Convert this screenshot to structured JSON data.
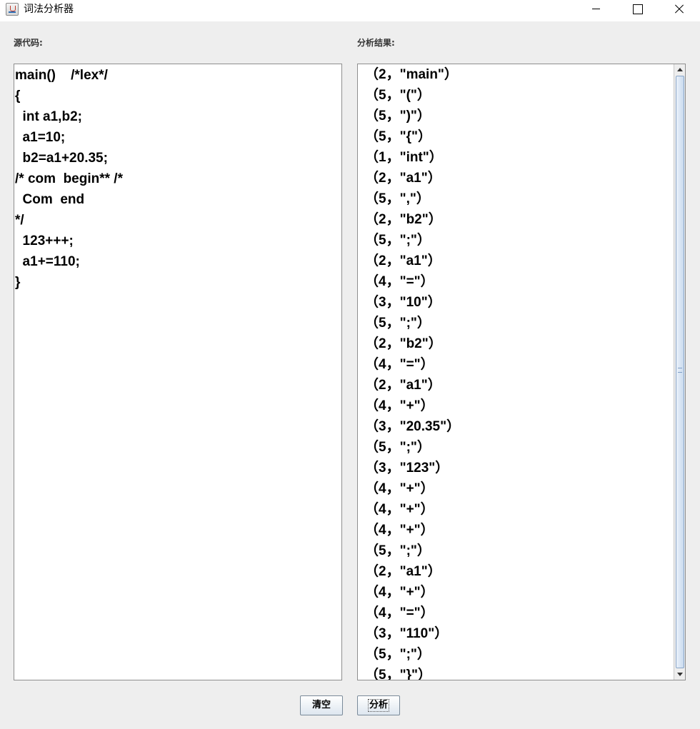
{
  "window": {
    "title": "词法分析器"
  },
  "labels": {
    "source": "源代码:",
    "result": "分析结果:"
  },
  "source_code": [
    "main()    /*lex*/",
    "{",
    "  int a1,b2;",
    "  a1=10;",
    "  b2=a1+20.35;",
    "/* com  begin** /*",
    "  Com  end",
    "*/",
    "  123+++;",
    "  a1+=110;",
    "}"
  ],
  "results": [
    "（2，\"main\"）",
    "（5，\"(\"）",
    "（5，\")\"）",
    "（5，\"{\"）",
    "（1，\"int\"）",
    "（2，\"a1\"）",
    "（5，\",\"）",
    "（2，\"b2\"）",
    "（5，\";\"）",
    "（2，\"a1\"）",
    "（4，\"=\"）",
    "（3，\"10\"）",
    "（5，\";\"）",
    "（2，\"b2\"）",
    "（4，\"=\"）",
    "（2，\"a1\"）",
    "（4，\"+\"）",
    "（3，\"20.35\"）",
    "（5，\";\"）",
    "（3，\"123\"）",
    "（4，\"+\"）",
    "（4，\"+\"）",
    "（4，\"+\"）",
    "（5，\";\"）",
    "（2，\"a1\"）",
    "（4，\"+\"）",
    "（4，\"=\"）",
    "（3，\"110\"）",
    "（5，\";\"）",
    "（5，\"}\"）"
  ],
  "buttons": {
    "clear": "清空",
    "analyze": "分析"
  },
  "icons": {
    "app": "java-coffee-cup-icon",
    "minimize": "minimize-icon",
    "maximize": "maximize-icon",
    "close": "close-icon"
  }
}
